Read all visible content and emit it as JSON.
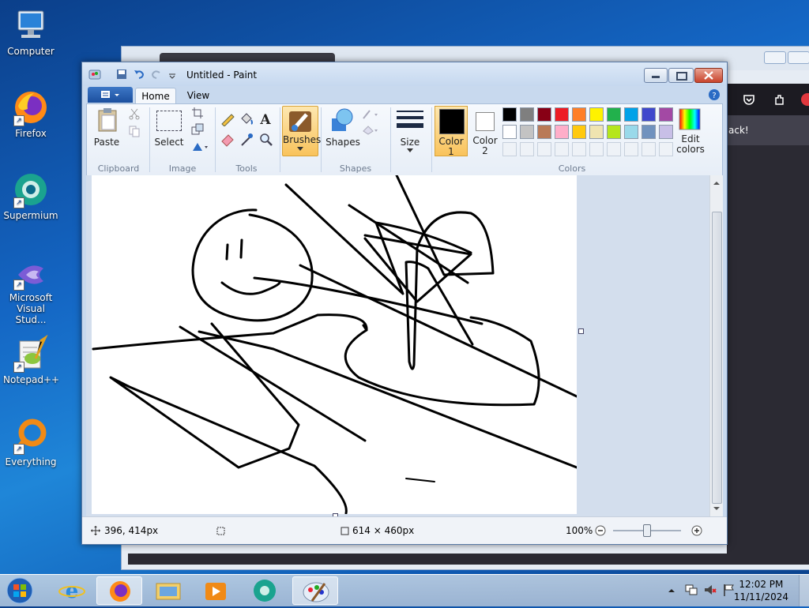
{
  "desktop": {
    "icons": [
      {
        "label": "Computer",
        "icon": "computer-icon"
      },
      {
        "label": "Firefox",
        "icon": "firefox-icon"
      },
      {
        "label": "Supermium",
        "icon": "supermium-icon"
      },
      {
        "label": "Microsoft Visual Stud...",
        "icon": "visual-studio-icon"
      },
      {
        "label": "Notepad++",
        "icon": "notepadpp-icon"
      },
      {
        "label": "Everything",
        "icon": "everything-icon"
      }
    ]
  },
  "background_window": {
    "partial_text": "ack!"
  },
  "paint": {
    "title": "Untitled - Paint",
    "tabs": [
      "Home",
      "View"
    ],
    "ribbon": {
      "clipboard": {
        "paste": "Paste",
        "group": "Clipboard"
      },
      "image": {
        "select": "Select",
        "group": "Image"
      },
      "tools": {
        "group": "Tools"
      },
      "brushes": {
        "label": "Brushes"
      },
      "shapes": {
        "label": "Shapes",
        "group": "Shapes"
      },
      "size": {
        "label": "Size"
      },
      "color1": {
        "label": "Color",
        "num": "1"
      },
      "color2": {
        "label": "Color",
        "num": "2"
      },
      "edit_colors": {
        "label": "Edit",
        "label2": "colors"
      },
      "colors_group": "Colors"
    },
    "palette_row1": [
      "#000000",
      "#7f7f7f",
      "#880015",
      "#ed1c24",
      "#ff7f27",
      "#fff200",
      "#22b14c",
      "#00a2e8",
      "#3f48cc",
      "#a349a4"
    ],
    "palette_row2": [
      "#ffffff",
      "#c3c3c3",
      "#b97a57",
      "#ffaec9",
      "#ffc90e",
      "#efe4b0",
      "#b5e61d",
      "#99d9ea",
      "#7092be",
      "#c8bfe7"
    ],
    "status": {
      "cursor_pos": "396, 414px",
      "image_size": "614 × 460px",
      "zoom": "100%"
    }
  },
  "taskbar": {
    "time": "12:02 PM",
    "date": "11/11/2024"
  }
}
